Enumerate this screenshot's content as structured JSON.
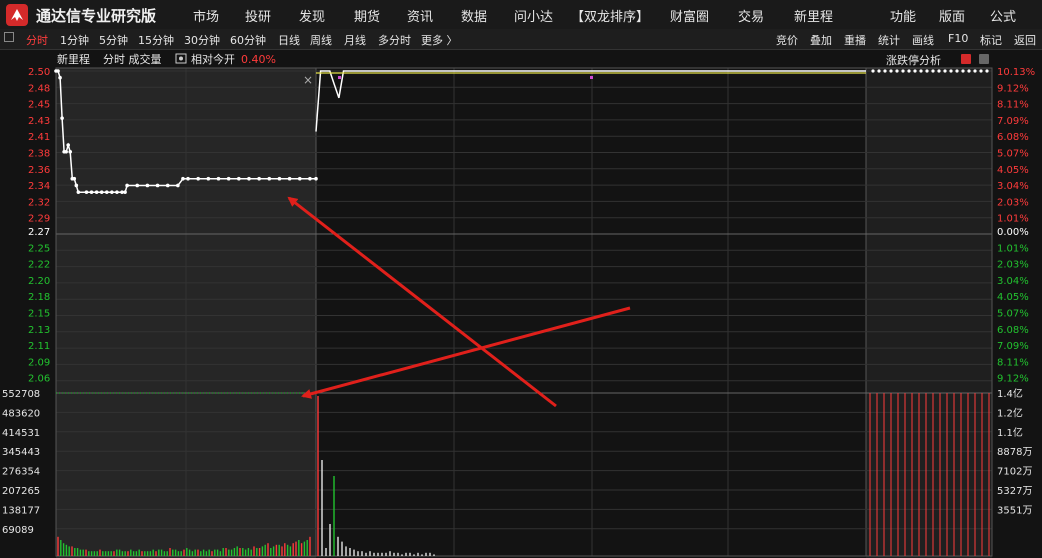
{
  "app": {
    "title": "通达信专业研究版"
  },
  "menu": [
    "市场",
    "投研",
    "发现",
    "期货",
    "资讯",
    "数据",
    "问小达",
    "【双龙排序】",
    "财富圈",
    "交易",
    "新里程"
  ],
  "menu_right": [
    "功能",
    "版面",
    "公式"
  ],
  "periods": [
    "分时",
    "1分钟",
    "5分钟",
    "15分钟",
    "30分钟",
    "60分钟",
    "日线",
    "周线",
    "月线",
    "多分时",
    "更多 〉"
  ],
  "active_period": "分时",
  "toolbar_right": [
    "竞价",
    "叠加",
    "重播",
    "统计",
    "画线",
    "F10",
    "标记",
    "返回"
  ],
  "chart_header": {
    "stock": "新里程",
    "mode": "分时 成交量",
    "relative": "相对今开",
    "relative_value": "0.40%",
    "side_title": "涨跌停分析"
  },
  "colors": {
    "up": "#ff3b3b",
    "down": "#22c22f",
    "price_line": "#ffffff",
    "avg_line": "#e5e24a",
    "annot": "#e0201b"
  },
  "chart_data": {
    "type": "line",
    "price_axis": {
      "up_labels": [
        "2.50",
        "2.48",
        "2.45",
        "2.43",
        "2.41",
        "2.38",
        "2.36",
        "2.34",
        "2.32",
        "2.29"
      ],
      "mid_label": "2.27",
      "down_labels": [
        "2.25",
        "2.22",
        "2.20",
        "2.18",
        "2.15",
        "2.13",
        "2.11",
        "2.09",
        "2.06"
      ],
      "ylim": [
        2.04,
        2.5
      ]
    },
    "pct_axis": {
      "up_labels": [
        "10.13%",
        "9.12%",
        "8.11%",
        "7.09%",
        "6.08%",
        "5.07%",
        "4.05%",
        "3.04%",
        "2.03%",
        "1.01%"
      ],
      "mid_label": "0.00%",
      "down_labels": [
        "1.01%",
        "2.03%",
        "3.04%",
        "4.05%",
        "5.07%",
        "6.08%",
        "7.09%",
        "8.11%",
        "9.12%"
      ]
    },
    "volume_axis": {
      "left_labels": [
        "552708",
        "483620",
        "414531",
        "345443",
        "276354",
        "207265",
        "138177",
        "69089"
      ],
      "right_labels": [
        "1.4亿",
        "1.2亿",
        "1.1亿",
        "8878万",
        "7102万",
        "5327万",
        "3551万"
      ]
    },
    "prev_day_price": [
      [
        0,
        2.5
      ],
      [
        2,
        2.5
      ],
      [
        4,
        2.49
      ],
      [
        6,
        2.43
      ],
      [
        8,
        2.38
      ],
      [
        10,
        2.38
      ],
      [
        12,
        2.39
      ],
      [
        14,
        2.38
      ],
      [
        16,
        2.34
      ],
      [
        18,
        2.34
      ],
      [
        20,
        2.33
      ],
      [
        22,
        2.32
      ],
      [
        30,
        2.32
      ],
      [
        35,
        2.32
      ],
      [
        40,
        2.32
      ],
      [
        45,
        2.32
      ],
      [
        50,
        2.32
      ],
      [
        55,
        2.32
      ],
      [
        60,
        2.32
      ],
      [
        65,
        2.32
      ],
      [
        68,
        2.32
      ],
      [
        70,
        2.33
      ],
      [
        80,
        2.33
      ],
      [
        90,
        2.33
      ],
      [
        100,
        2.33
      ],
      [
        110,
        2.33
      ],
      [
        120,
        2.33
      ],
      [
        125,
        2.34
      ],
      [
        130,
        2.34
      ],
      [
        140,
        2.34
      ],
      [
        150,
        2.34
      ],
      [
        160,
        2.34
      ],
      [
        170,
        2.34
      ],
      [
        180,
        2.34
      ],
      [
        190,
        2.34
      ],
      [
        200,
        2.34
      ],
      [
        210,
        2.34
      ],
      [
        220,
        2.34
      ],
      [
        230,
        2.34
      ],
      [
        240,
        2.34
      ],
      [
        250,
        2.34
      ],
      [
        256,
        2.34
      ]
    ],
    "today_price": [
      [
        0,
        2.41
      ],
      [
        2,
        2.5
      ],
      [
        4,
        2.5
      ],
      [
        6,
        2.5
      ],
      [
        8,
        2.48
      ],
      [
        10,
        2.46
      ],
      [
        12,
        2.5
      ],
      [
        14,
        2.5
      ],
      [
        240,
        2.5
      ]
    ],
    "today_avg": [
      [
        0,
        2.5
      ],
      [
        240,
        2.5
      ]
    ],
    "prev_volume": [
      12,
      10,
      8,
      7,
      6,
      6,
      5,
      5,
      4,
      4,
      4,
      3,
      3,
      3,
      3,
      4,
      3,
      3,
      3,
      3,
      3,
      4,
      4,
      3,
      3,
      3,
      4,
      3,
      3,
      4,
      3,
      3,
      3,
      3,
      4,
      3,
      4,
      4,
      3,
      3,
      5,
      4,
      4,
      3,
      3,
      4,
      5,
      4,
      3,
      4,
      4,
      3,
      4,
      3,
      4,
      3,
      4,
      4,
      3,
      5,
      5,
      4,
      4,
      5,
      6,
      5,
      5,
      4,
      5,
      4,
      6,
      5,
      5,
      6,
      7,
      8,
      5,
      6,
      7,
      7,
      6,
      8,
      7,
      6,
      8,
      9,
      10,
      8,
      9,
      10,
      12
    ],
    "today_volume": [
      100,
      60,
      5,
      20,
      50,
      12,
      9,
      6,
      5,
      4,
      3,
      3,
      2,
      3,
      2,
      2,
      2,
      2,
      3,
      2,
      2,
      1,
      2,
      2,
      1,
      2,
      1,
      2,
      2,
      1
    ],
    "side_limit_bars": 18,
    "annotations": [
      "arrow-to-price-line",
      "arrow-to-volume-spike"
    ]
  }
}
